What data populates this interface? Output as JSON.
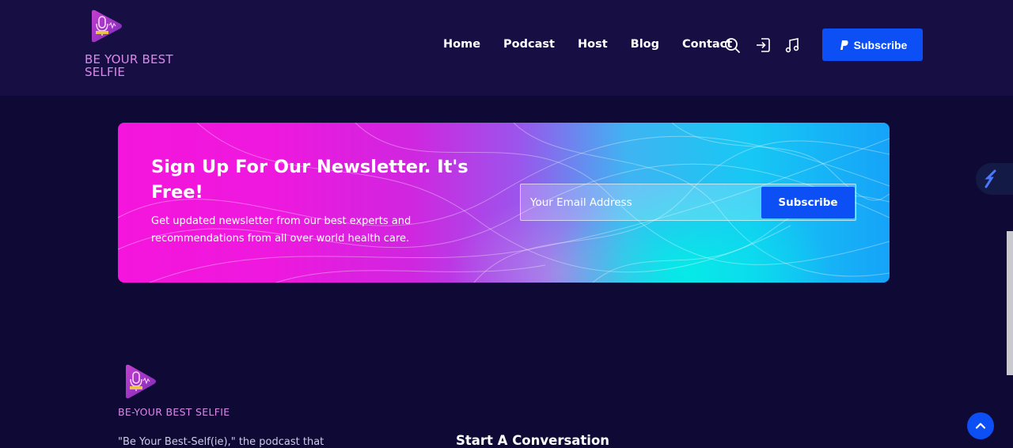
{
  "brand": {
    "name": "BE YOUR BEST SELFIE",
    "colors": {
      "accent": "#0c4ff5",
      "brand_text": "#d98ae8",
      "page_bg": "#0f0a35",
      "header_bg": "#170f44"
    }
  },
  "nav": {
    "items": [
      {
        "label": "Home"
      },
      {
        "label": "Podcast"
      },
      {
        "label": "Host"
      },
      {
        "label": "Blog"
      },
      {
        "label": "Contact"
      }
    ],
    "icons": [
      "search-icon",
      "login-icon",
      "music-note-icon"
    ],
    "subscribe_label": "Subscribe",
    "subscribe_icon": "paypal-icon"
  },
  "newsletter": {
    "title": "Sign Up For Our Newsletter. It's Free!",
    "description": "Get updated newsletter from our best experts and recommendations from all over world health care.",
    "email_placeholder": "Your Email Address",
    "button_label": "Subscribe"
  },
  "footer": {
    "brand": "BE-YOUR BEST SELFIE",
    "description": "\"Be Your Best-Self(ie),\" the podcast that",
    "heading": "Start A Conversation"
  }
}
